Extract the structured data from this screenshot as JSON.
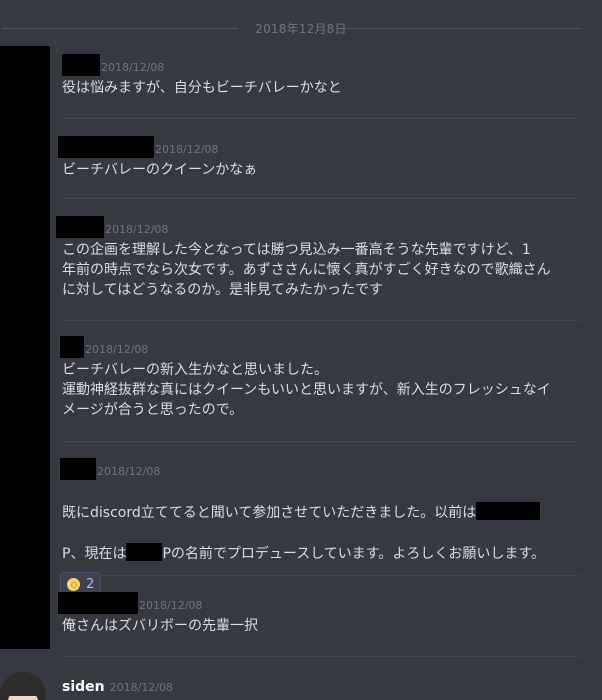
{
  "date_divider": "2018年12月8日",
  "messages": [
    {
      "timestamp": "2018/12/08",
      "content": "役は悩みますが、自分もビーチバレーかなと"
    },
    {
      "timestamp": "2018/12/08",
      "content": "ビーチバレーのクイーンかなぁ"
    },
    {
      "timestamp": "2018/12/08",
      "content": "この企画を理解した今となっては勝つ見込み一番高そうな先輩ですけど、1\n年前の時点でなら次女です。あずささんに懐く真がすごく好きなので歌織さん\nに対してはどうなるのか。是非見てみたかったです"
    },
    {
      "timestamp": "2018/12/08",
      "content": "ビーチバレーの新入生かなと思いました。\n運動神経抜群な真にはクイーンもいいと思いますが、新入生のフレッシュなイ\nメージが合うと思ったので。"
    },
    {
      "timestamp": "2018/12/08",
      "content_part1": "既にdiscord立ててると聞いて参加させていただきました。以前は",
      "content_part2": "P、現在は",
      "content_part3": "Pの名前でプロデュースしています。よろしくお願いします。",
      "reaction_count": "2"
    },
    {
      "timestamp": "2018/12/08",
      "content": "俺さんはズバリボーの先輩一択"
    },
    {
      "author": "siden",
      "timestamp": "2018/12/08"
    }
  ]
}
